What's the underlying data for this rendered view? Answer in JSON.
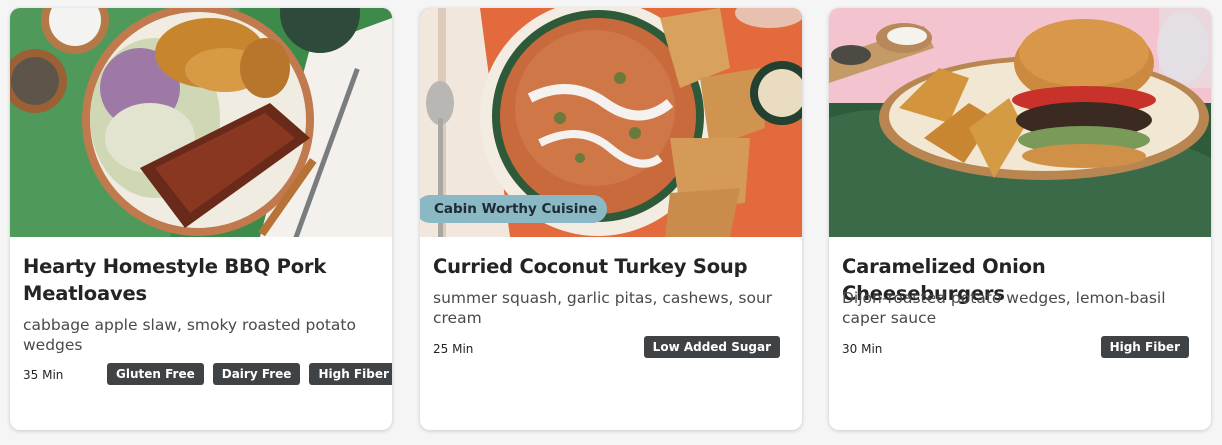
{
  "recipes": [
    {
      "title": "Hearty Homestyle BBQ Pork Meatloaves",
      "subtitle": "cabbage apple slaw, smoky roasted potato wedges",
      "time": "35 Min",
      "tags": [
        "Gluten Free",
        "Dairy Free",
        "High Fiber"
      ],
      "image_icon": "bbq-meatloaf-plate-photo"
    },
    {
      "title": "Curried Coconut Turkey Soup",
      "subtitle": "summer squash, garlic pitas, cashews, sour cream",
      "time": "25 Min",
      "badge": "Cabin Worthy Cuisine",
      "tags": [
        "Low Added Sugar"
      ],
      "image_icon": "curry-soup-bowl-photo"
    },
    {
      "title": "Caramelized Onion Cheeseburgers",
      "subtitle": "Dijon-roasted potato wedges, lemon-basil caper sauce",
      "time": "30 Min",
      "tags": [
        "High Fiber"
      ],
      "image_icon": "cheeseburger-plate-photo"
    }
  ],
  "colors": {
    "tag_bg": "#3f4346",
    "badge_bg": "#8ab8c5",
    "card_bg": "#ffffff",
    "page_bg": "#f5f5f5"
  }
}
